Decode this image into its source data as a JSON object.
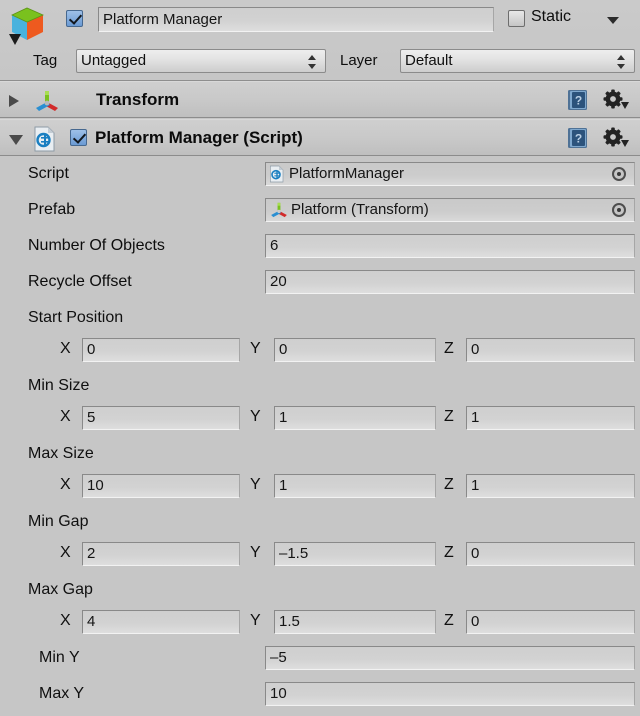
{
  "header": {
    "object_icon": "gameobject-cube-icon",
    "enabled": true,
    "name": "Platform Manager",
    "static_label": "Static",
    "static_checked": false,
    "tag_label": "Tag",
    "tag_value": "Untagged",
    "layer_label": "Layer",
    "layer_value": "Default"
  },
  "components": [
    {
      "title": "Transform",
      "icon": "transform-axis-icon",
      "expanded": false,
      "has_enable_toggle": false,
      "enabled": false
    },
    {
      "title": "Platform Manager (Script)",
      "icon": "csharp-script-icon",
      "expanded": true,
      "has_enable_toggle": true,
      "enabled": true
    }
  ],
  "help_icon": "help-book-icon",
  "gear_icon": "gear-icon",
  "object_picker_icon": "object-picker-icon",
  "properties": {
    "script": {
      "label": "Script",
      "value": "PlatformManager",
      "icon": "csharp-script-icon"
    },
    "prefab": {
      "label": "Prefab",
      "value": "Platform (Transform)",
      "icon": "transform-axis-icon"
    },
    "number_of_objects": {
      "label": "Number Of Objects",
      "value": "6"
    },
    "recycle_offset": {
      "label": "Recycle Offset",
      "value": "20"
    },
    "min_y": {
      "label": "Min Y",
      "value": "–5"
    },
    "max_y": {
      "label": "Max Y",
      "value": "10"
    }
  },
  "vectors": [
    {
      "title": "Start Position",
      "x_label": "X",
      "y_label": "Y",
      "z_label": "Z",
      "x": "0",
      "y": "0",
      "z": "0"
    },
    {
      "title": "Min Size",
      "x_label": "X",
      "y_label": "Y",
      "z_label": "Z",
      "x": "5",
      "y": "1",
      "z": "1"
    },
    {
      "title": "Max Size",
      "x_label": "X",
      "y_label": "Y",
      "z_label": "Z",
      "x": "10",
      "y": "1",
      "z": "1"
    },
    {
      "title": "Min Gap",
      "x_label": "X",
      "y_label": "Y",
      "z_label": "Z",
      "x": "2",
      "y": "–1.5",
      "z": "0"
    },
    {
      "title": "Max Gap",
      "x_label": "X",
      "y_label": "Y",
      "z_label": "Z",
      "x": "4",
      "y": "1.5",
      "z": "0"
    }
  ],
  "colors": {
    "background": "#c6c6c6",
    "field": "#d2d2d2",
    "border": "#898989",
    "checkbox_accent": "#6a9ad4",
    "axis_x": "#d22a2a",
    "axis_y": "#7ac11e",
    "axis_z": "#2a8fd2"
  }
}
